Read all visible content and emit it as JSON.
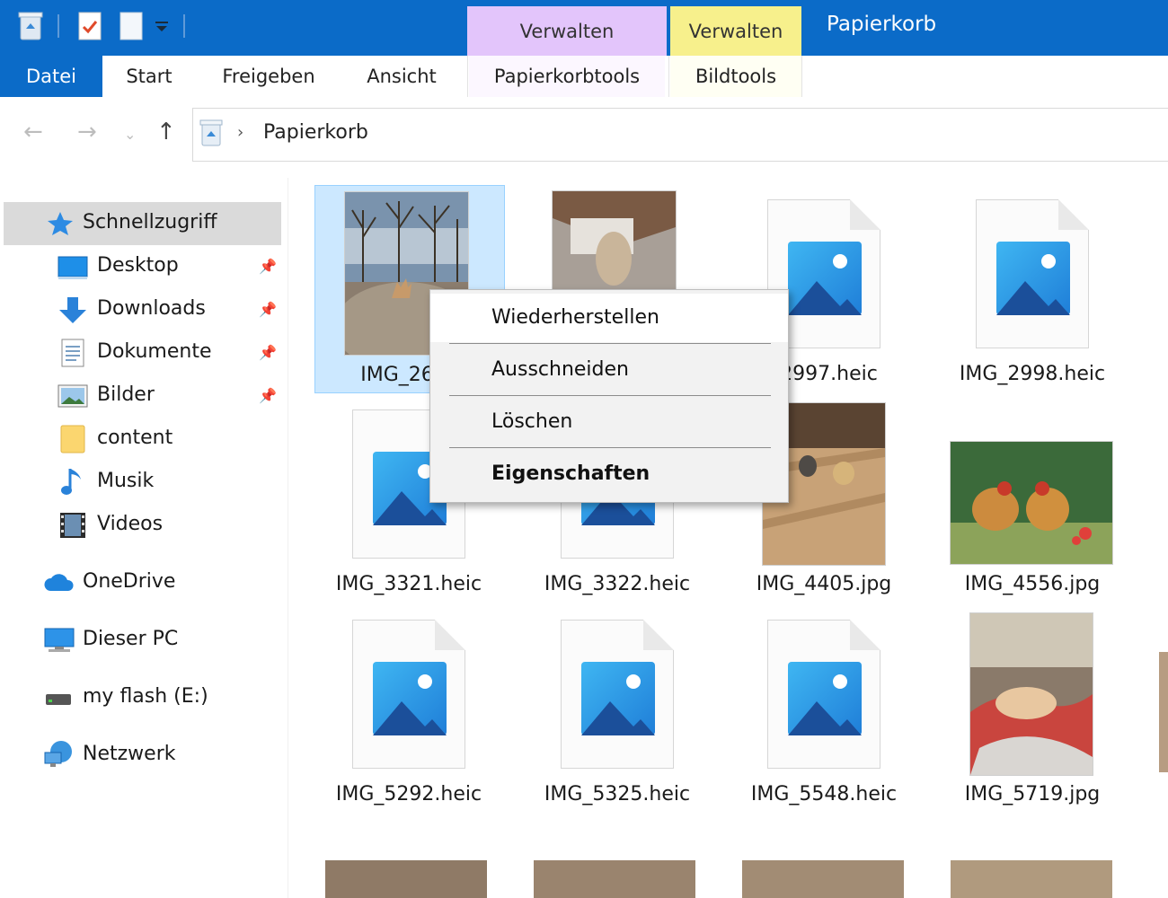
{
  "window": {
    "title": "Papierkorb"
  },
  "contextual_tabs": [
    {
      "group": "Verwalten",
      "tab": "Papierkorbtools",
      "color": "#e3c5fb"
    },
    {
      "group": "Verwalten",
      "tab": "Bildtools",
      "color": "#f7f08c"
    }
  ],
  "ribbon": {
    "tabs": [
      "Datei",
      "Start",
      "Freigeben",
      "Ansicht"
    ]
  },
  "address": {
    "path": "Papierkorb"
  },
  "sidebar": {
    "quick_access": "Schnellzugriff",
    "items": [
      {
        "label": "Desktop",
        "icon": "desktop-icon",
        "pinned": true
      },
      {
        "label": "Downloads",
        "icon": "downloads-icon",
        "pinned": true
      },
      {
        "label": "Dokumente",
        "icon": "documents-icon",
        "pinned": true
      },
      {
        "label": "Bilder",
        "icon": "pictures-icon",
        "pinned": true
      },
      {
        "label": "content",
        "icon": "folder-icon",
        "pinned": false
      },
      {
        "label": "Musik",
        "icon": "music-icon",
        "pinned": false
      },
      {
        "label": "Videos",
        "icon": "videos-icon",
        "pinned": false
      }
    ],
    "roots": [
      {
        "label": "OneDrive",
        "icon": "onedrive-icon"
      },
      {
        "label": "Dieser PC",
        "icon": "pc-icon"
      },
      {
        "label": "my flash (E:)",
        "icon": "drive-icon"
      },
      {
        "label": "Netzwerk",
        "icon": "network-icon"
      }
    ]
  },
  "files": [
    {
      "name": "IMG_2613",
      "kind": "photo",
      "selected": true
    },
    {
      "name": "",
      "kind": "photo"
    },
    {
      "name": "_2997.heic",
      "kind": "heic"
    },
    {
      "name": "IMG_2998.heic",
      "kind": "heic"
    },
    {
      "name": "IMG_3321.heic",
      "kind": "heic"
    },
    {
      "name": "IMG_3322.heic",
      "kind": "heic"
    },
    {
      "name": "IMG_4405.jpg",
      "kind": "photo"
    },
    {
      "name": "IMG_4556.jpg",
      "kind": "photo"
    },
    {
      "name": "IMG_5292.heic",
      "kind": "heic"
    },
    {
      "name": "IMG_5325.heic",
      "kind": "heic"
    },
    {
      "name": "IMG_5548.heic",
      "kind": "heic"
    },
    {
      "name": "IMG_5719.jpg",
      "kind": "photo"
    }
  ],
  "context_menu": {
    "items": [
      "Wiederherstellen",
      "Ausschneiden",
      "Löschen",
      "Eigenschaften"
    ],
    "default_item": "Eigenschaften",
    "hovered_item": "Wiederherstellen"
  },
  "colors": {
    "accent": "#0b6bc8",
    "selection": "#cce8ff",
    "heic_icon_light": "#35a3e8",
    "heic_icon_dark": "#1b4f9a"
  }
}
